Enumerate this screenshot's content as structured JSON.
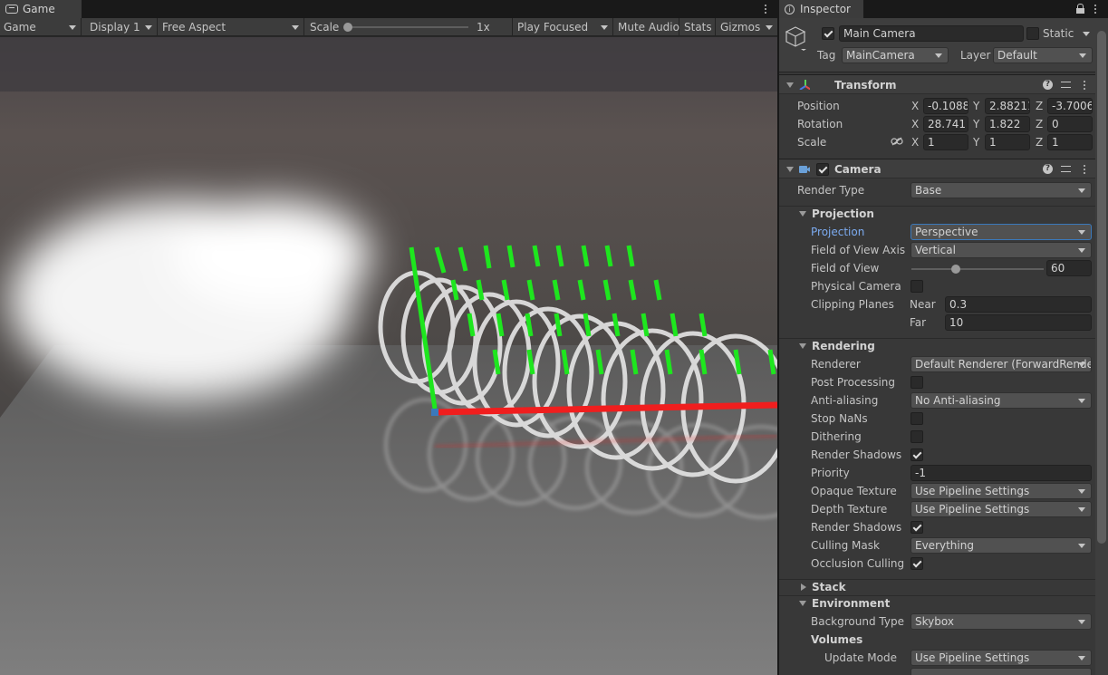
{
  "game_window": {
    "tab_title": "Game",
    "toolbar": {
      "mode": "Game",
      "display": "Display 1",
      "aspect": "Free Aspect",
      "scale_label": "Scale",
      "scale_value": "1x",
      "play_mode": "Play Focused",
      "mute_audio": "Mute Audio",
      "stats": "Stats",
      "gizmos": "Gizmos"
    }
  },
  "inspector": {
    "tab_title": "Inspector",
    "object": {
      "active": true,
      "name": "Main Camera",
      "static_label": "Static",
      "static": false,
      "tag_label": "Tag",
      "tag": "MainCamera",
      "layer_label": "Layer",
      "layer": "Default"
    },
    "transform": {
      "title": "Transform",
      "position_label": "Position",
      "rotation_label": "Rotation",
      "scale_label": "Scale",
      "axis_x": "X",
      "axis_y": "Y",
      "axis_z": "Z",
      "position": {
        "x": "-0.1088",
        "y": "2.88211",
        "z": "-3.7006"
      },
      "rotation": {
        "x": "28.741",
        "y": "1.822",
        "z": "0"
      },
      "scale": {
        "x": "1",
        "y": "1",
        "z": "1"
      }
    },
    "camera": {
      "title": "Camera",
      "enabled": true,
      "render_type_label": "Render Type",
      "render_type": "Base",
      "projection_section": "Projection",
      "projection_label": "Projection",
      "projection": "Perspective",
      "fov_axis_label": "Field of View Axis",
      "fov_axis": "Vertical",
      "fov_label": "Field of View",
      "fov_value": "60",
      "fov_slider_fraction": 0.34,
      "physical_camera_label": "Physical Camera",
      "physical_camera": false,
      "clipping_planes_label": "Clipping Planes",
      "near_label": "Near",
      "near": "0.3",
      "far_label": "Far",
      "far": "10",
      "rendering_section": "Rendering",
      "renderer_label": "Renderer",
      "renderer": "Default Renderer (ForwardRende",
      "post_processing_label": "Post Processing",
      "post_processing": false,
      "anti_aliasing_label": "Anti-aliasing",
      "anti_aliasing": "No Anti-aliasing",
      "stop_nans_label": "Stop NaNs",
      "stop_nans": false,
      "dithering_label": "Dithering",
      "dithering": false,
      "render_shadows_label": "Render Shadows",
      "render_shadows": true,
      "priority_label": "Priority",
      "priority": "-1",
      "opaque_texture_label": "Opaque Texture",
      "opaque_texture": "Use Pipeline Settings",
      "depth_texture_label": "Depth Texture",
      "depth_texture": "Use Pipeline Settings",
      "render_shadows2_label": "Render Shadows",
      "render_shadows2": true,
      "culling_mask_label": "Culling Mask",
      "culling_mask": "Everything",
      "occlusion_culling_label": "Occlusion Culling",
      "occlusion_culling": true,
      "stack_section": "Stack",
      "environment_section": "Environment",
      "background_type_label": "Background Type",
      "background_type": "Skybox",
      "volumes_label": "Volumes",
      "update_mode_label": "Update Mode",
      "update_mode": "Use Pipeline Settings"
    }
  },
  "colors": {
    "accent_blue": "#3a79bb",
    "axis_green": "#1ee61e",
    "axis_red": "#f01e1e",
    "panel_bg": "#383838"
  },
  "icons": {
    "game_tab": "gamepad-icon",
    "inspector_tab": "info-icon",
    "object": "cube-icon",
    "transform": "transform-axes-icon",
    "camera": "camera-icon",
    "help": "help-icon",
    "presets": "presets-icon",
    "menu": "kebab-menu-icon",
    "lock": "lock-icon",
    "link": "link-icon"
  }
}
